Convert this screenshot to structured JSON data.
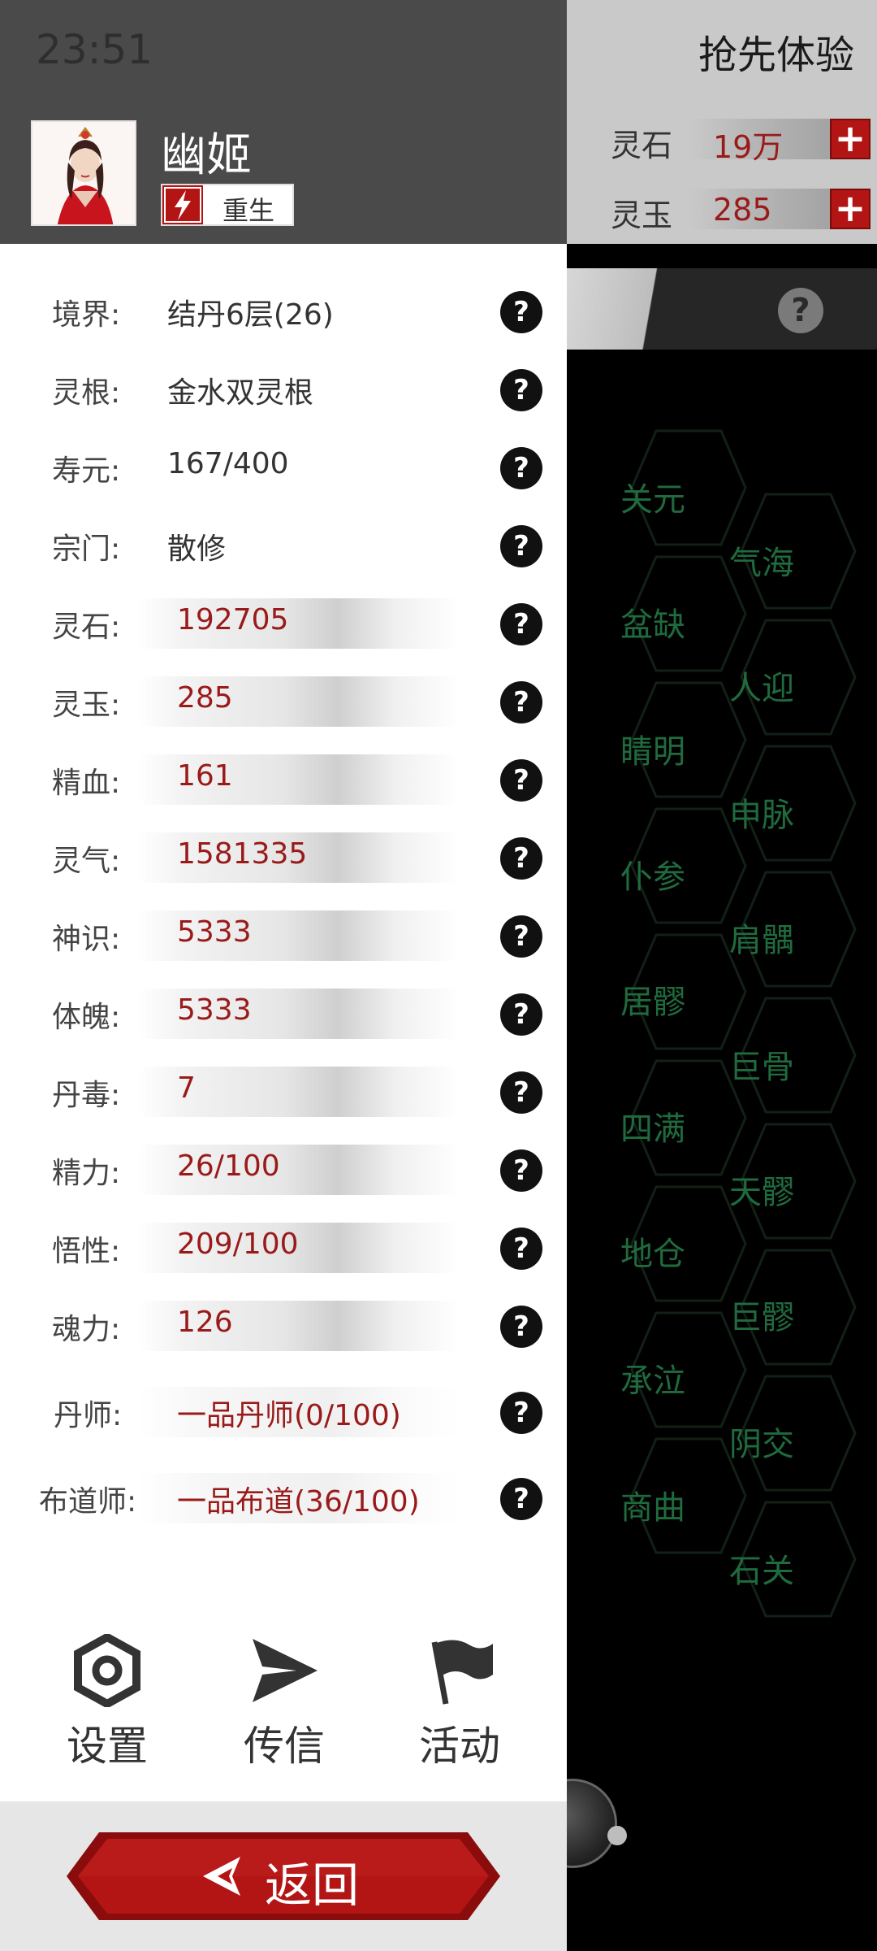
{
  "status_bar": {
    "time": "23:51"
  },
  "background": {
    "title": "抢先体验",
    "resources": [
      {
        "label": "灵石",
        "value": "19万",
        "plus": "+"
      },
      {
        "label": "灵玉",
        "value": "285",
        "plus": "+"
      }
    ],
    "help_symbol": "?",
    "acupoints_left": [
      "关元",
      "盆缺",
      "睛明",
      "仆参",
      "居髎",
      "四满",
      "地仓",
      "承泣",
      "商曲"
    ],
    "acupoints_right": [
      "气海",
      "人迎",
      "申脉",
      "肩髃",
      "巨骨",
      "天髎",
      "巨髎",
      "阴交",
      "石关"
    ],
    "acupoint_color": "#1f6b3e"
  },
  "character": {
    "name": "幽姬",
    "rebirth_label": "重生"
  },
  "stats": [
    {
      "label": "境界:",
      "value": "结丹6层(26)",
      "style": "plain"
    },
    {
      "label": "灵根:",
      "value": "金水双灵根",
      "style": "plain"
    },
    {
      "label": "寿元:",
      "value": "167/400",
      "style": "plain"
    },
    {
      "label": "宗门:",
      "value": "散修",
      "style": "plain"
    },
    {
      "label": "灵石:",
      "value": "192705",
      "style": "bar"
    },
    {
      "label": "灵玉:",
      "value": "285",
      "style": "bar"
    },
    {
      "label": "精血:",
      "value": "161",
      "style": "bar"
    },
    {
      "label": "灵气:",
      "value": "1581335",
      "style": "bar"
    },
    {
      "label": "神识:",
      "value": "5333",
      "style": "bar"
    },
    {
      "label": "体魄:",
      "value": "5333",
      "style": "bar"
    },
    {
      "label": "丹毒:",
      "value": "7",
      "style": "bar"
    },
    {
      "label": "精力:",
      "value": "26/100",
      "style": "bar"
    },
    {
      "label": "悟性:",
      "value": "209/100",
      "style": "bar"
    },
    {
      "label": "魂力:",
      "value": "126",
      "style": "bar"
    },
    {
      "label": "丹师:",
      "value": "一品丹师(0/100)",
      "style": "light"
    },
    {
      "label": "布道师:",
      "value": "一品布道(36/100)",
      "style": "light"
    }
  ],
  "help_symbol": "?",
  "actions": [
    {
      "label": "设置",
      "icon": "settings-icon"
    },
    {
      "label": "传信",
      "icon": "send-icon"
    },
    {
      "label": "活动",
      "icon": "flag-icon"
    }
  ],
  "back_button": {
    "label": "返回"
  },
  "colors": {
    "accent_red": "#b31414",
    "value_red": "#9a1a1a",
    "header_gray": "#4a4a4a"
  }
}
